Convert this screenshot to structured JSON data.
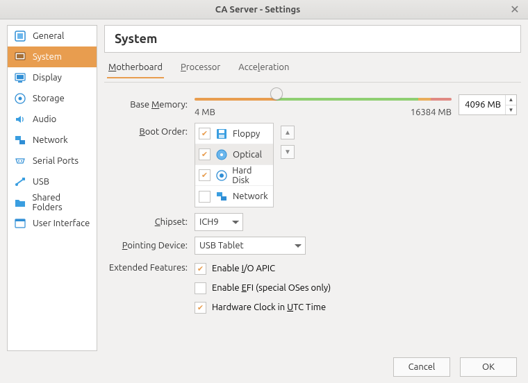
{
  "window": {
    "title": "CA Server - Settings"
  },
  "sidebar": {
    "items": [
      {
        "label": "General"
      },
      {
        "label": "System"
      },
      {
        "label": "Display"
      },
      {
        "label": "Storage"
      },
      {
        "label": "Audio"
      },
      {
        "label": "Network"
      },
      {
        "label": "Serial Ports"
      },
      {
        "label": "USB"
      },
      {
        "label": "Shared Folders"
      },
      {
        "label": "User Interface"
      }
    ],
    "selected_index": 1
  },
  "section_title": "System",
  "tabs": {
    "items": [
      {
        "pre": "",
        "u": "M",
        "post": "otherboard"
      },
      {
        "pre": "",
        "u": "P",
        "post": "rocessor"
      },
      {
        "pre": "Acce",
        "u": "l",
        "post": "eration"
      }
    ],
    "active_index": 0
  },
  "base_memory": {
    "label_pre": "Base ",
    "label_u": "M",
    "label_post": "emory:",
    "value": "4096 MB",
    "min": "4 MB",
    "max": "16384 MB"
  },
  "boot_order": {
    "label_u": "B",
    "label_post": "oot Order:",
    "items": [
      {
        "label": "Floppy",
        "checked": true,
        "selected": false
      },
      {
        "label": "Optical",
        "checked": true,
        "selected": true
      },
      {
        "label": "Hard Disk",
        "checked": true,
        "selected": false
      },
      {
        "label": "Network",
        "checked": false,
        "selected": false
      }
    ]
  },
  "chipset": {
    "label_u": "C",
    "label_post": "hipset:",
    "value": "ICH9"
  },
  "pointing": {
    "label_pre": "",
    "label_u": "P",
    "label_post": "ointing Device:",
    "value": "USB Tablet"
  },
  "extended": {
    "label": "Extended Features:",
    "io_apic": {
      "pre": "Enable ",
      "u": "I",
      "post": "/O APIC",
      "checked": true
    },
    "efi": {
      "pre": "Enable ",
      "u": "E",
      "post": "FI (special OSes only)",
      "checked": false
    },
    "utc": {
      "pre": "Hardware Clock in ",
      "u": "U",
      "post": "TC Time",
      "checked": true
    }
  },
  "footer": {
    "cancel": "Cancel",
    "ok": "OK"
  }
}
